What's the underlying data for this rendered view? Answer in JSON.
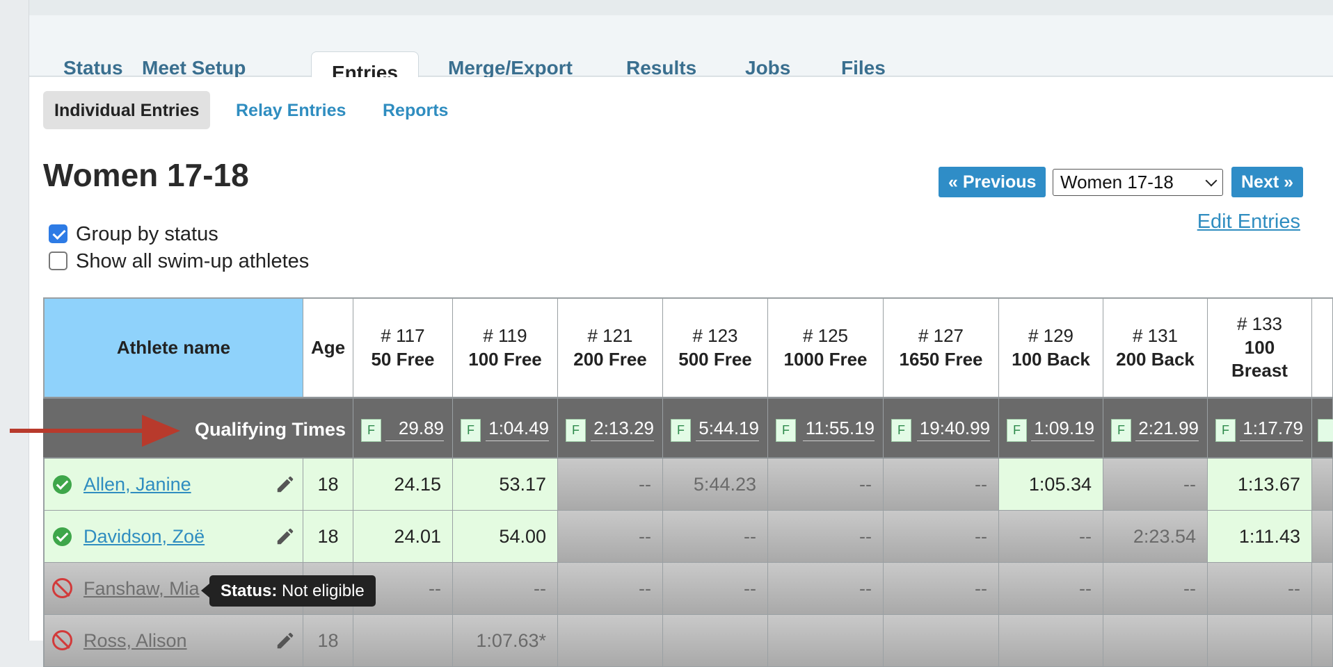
{
  "tabs": [
    {
      "label": "Status"
    },
    {
      "label": "Meet Setup"
    },
    {
      "label": "Entries"
    },
    {
      "label": "Merge/Export"
    },
    {
      "label": "Results"
    },
    {
      "label": "Jobs"
    },
    {
      "label": "Files"
    }
  ],
  "active_tab": "Entries",
  "subtabs": [
    {
      "label": "Individual Entries"
    },
    {
      "label": "Relay Entries"
    },
    {
      "label": "Reports"
    }
  ],
  "page_title": "Women 17-18",
  "nav": {
    "previous_label": "« Previous",
    "next_label": "Next »",
    "group_select_value": "Women 17-18",
    "edit_entries_label": "Edit Entries"
  },
  "options": {
    "group_by_status": {
      "label": "Group by status",
      "checked": true
    },
    "show_swim_up": {
      "label": "Show all swim-up athletes",
      "checked": false
    }
  },
  "table": {
    "athlete_header": "Athlete name",
    "age_header": "Age",
    "events": [
      {
        "num": "# 117",
        "name": "50 Free"
      },
      {
        "num": "# 119",
        "name": "100 Free"
      },
      {
        "num": "# 121",
        "name": "200 Free"
      },
      {
        "num": "# 123",
        "name": "500 Free"
      },
      {
        "num": "# 125",
        "name": "1000 Free"
      },
      {
        "num": "# 127",
        "name": "1650 Free"
      },
      {
        "num": "# 129",
        "name": "100 Back"
      },
      {
        "num": "# 131",
        "name": "200 Back"
      },
      {
        "num": "# 133",
        "name": "100 Breast"
      }
    ],
    "qualifying_label": "Qualifying Times",
    "qualifying_badge": "F",
    "qualifying_times": [
      "29.89",
      "1:04.49",
      "2:13.29",
      "5:44.19",
      "11:55.19",
      "19:40.99",
      "1:09.19",
      "2:21.99",
      "1:17.79"
    ],
    "rows": [
      {
        "name": "Allen, Janine",
        "age": "18",
        "status": "ok",
        "times": [
          "24.15",
          "53.17",
          "--",
          "5:44.23",
          "--",
          "--",
          "1:05.34",
          "--",
          "1:13.67"
        ],
        "qualified": [
          true,
          true,
          false,
          false,
          false,
          false,
          true,
          false,
          true
        ]
      },
      {
        "name": "Davidson, Zoë",
        "age": "18",
        "status": "ok",
        "times": [
          "24.01",
          "54.00",
          "--",
          "--",
          "--",
          "--",
          "--",
          "2:23.54",
          "1:11.43"
        ],
        "qualified": [
          true,
          true,
          false,
          false,
          false,
          false,
          false,
          false,
          true
        ]
      },
      {
        "name": "Fanshaw, Mia",
        "age": "",
        "status": "no",
        "times": [
          "--",
          "--",
          "--",
          "--",
          "--",
          "--",
          "--",
          "--",
          "--"
        ],
        "qualified": [
          false,
          false,
          false,
          false,
          false,
          false,
          false,
          false,
          false
        ]
      },
      {
        "name": "Ross, Alison",
        "age": "18",
        "status": "no",
        "times": [
          "",
          "1:07.63*",
          "",
          "",
          "",
          "",
          "",
          "",
          ""
        ],
        "qualified": [
          false,
          false,
          false,
          false,
          false,
          false,
          false,
          false,
          false
        ]
      }
    ]
  },
  "tooltip": {
    "bold": "Status:",
    "text": "Not eligible"
  },
  "colors": {
    "accent_blue": "#2f8dc7",
    "athlete_header_bg": "#8fd2fb",
    "qualified_bg": "#e4fbe1",
    "qualifying_row_bg": "#6a6a6a",
    "status_ok": "#3ea64a",
    "status_not_eligible": "#d23a3a",
    "arrow": "#b83a2c"
  },
  "icons": {
    "edit": "pencil-icon",
    "status_ok": "check-circle-icon",
    "status_not_eligible": "no-entry-icon",
    "annotation": "arrow-right-icon"
  }
}
